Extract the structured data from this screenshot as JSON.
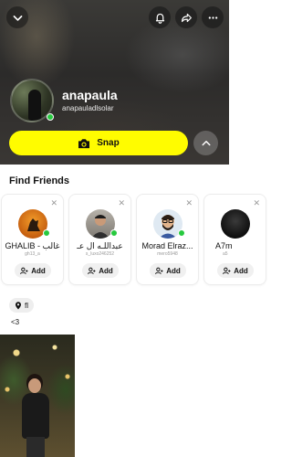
{
  "profile": {
    "display_name": "anapaula",
    "username": "anapauladlsolar"
  },
  "actions": {
    "snap_label": "Snap"
  },
  "find_friends": {
    "title": "Find Friends",
    "cards": [
      {
        "name": "GHALIB - غالب",
        "sub": "gh13_a",
        "add_label": "Add"
      },
      {
        "name": "عبداللـه ال عـ",
        "sub": "s_luxo246252",
        "add_label": "Add"
      },
      {
        "name": "Morad Elraz...",
        "sub": "mero5948",
        "add_label": "Add"
      },
      {
        "name": "A7m",
        "sub": "a5",
        "add_label": "Add"
      }
    ]
  },
  "location": {
    "label": "fl"
  },
  "bio": "<3",
  "colors": {
    "snap_yellow": "#fffc00",
    "online_green": "#27c93f"
  },
  "icons": {
    "back": "chevron-down-icon",
    "notifications": "bell-icon",
    "share": "share-arrow-icon",
    "more": "more-horizontal-icon",
    "camera": "camera-icon",
    "collapse": "chevron-up-icon",
    "dismiss": "close-icon",
    "add_friend": "person-plus-icon",
    "location": "location-pin-icon"
  }
}
